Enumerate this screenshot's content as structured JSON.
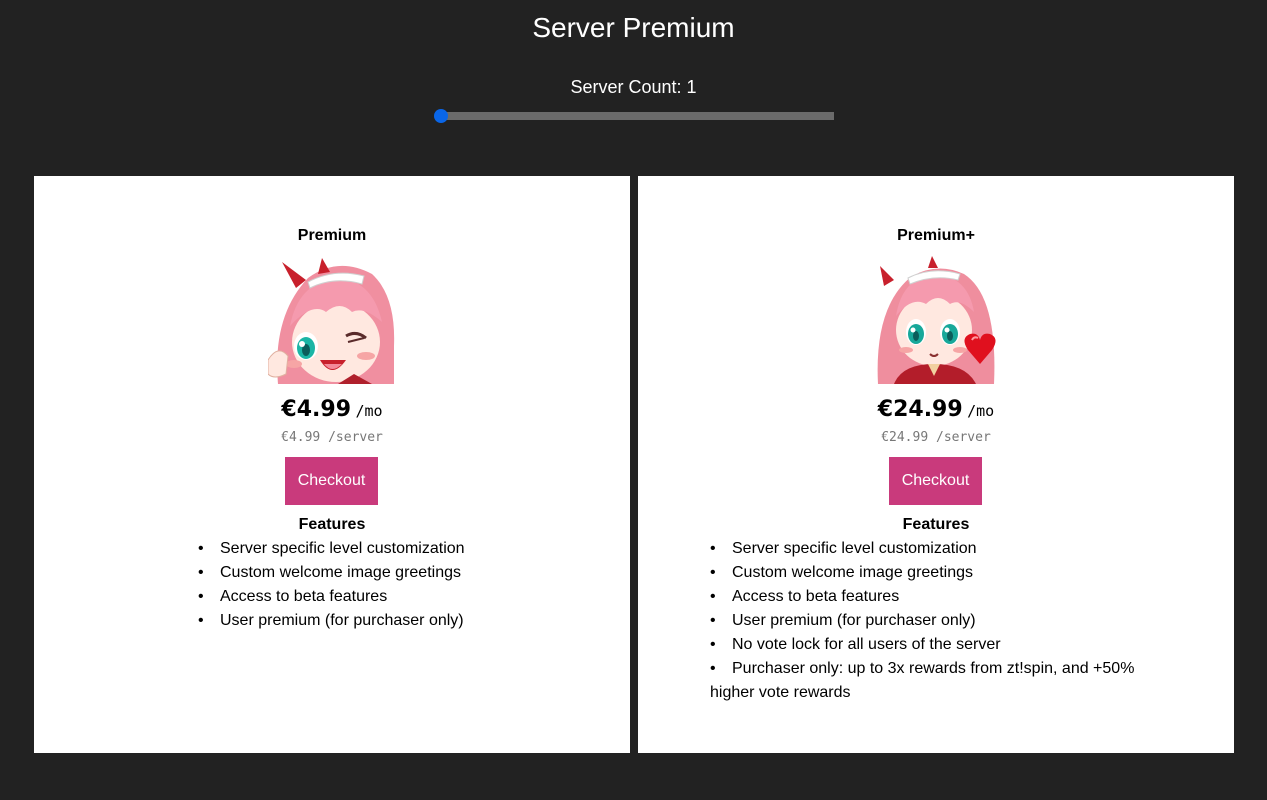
{
  "header": {
    "title": "Server Premium",
    "server_count_label": "Server Count: 1"
  },
  "slider": {
    "value": 1,
    "min": 1,
    "fraction": 0,
    "accent_color": "#0a66e8"
  },
  "tiers": [
    {
      "name": "Premium",
      "avatar_icon": "anime-girl-wink-avatar",
      "price": "€4.99",
      "price_unit": "/mo",
      "per_server": "€4.99 /server",
      "checkout_label": "Checkout",
      "features_title": "Features",
      "features": [
        "Server specific level customization",
        "Custom welcome image greetings",
        "Access to beta features",
        "User premium (for purchaser only)"
      ]
    },
    {
      "name": "Premium+",
      "avatar_icon": "anime-girl-heart-avatar",
      "price": "€24.99",
      "price_unit": "/mo",
      "per_server": "€24.99 /server",
      "checkout_label": "Checkout",
      "features_title": "Features",
      "features": [
        "Server specific level customization",
        "Custom welcome image greetings",
        "Access to beta features",
        "User premium (for purchaser only)",
        "No vote lock for all users of the server",
        "Purchaser only: up to 3x rewards from zt!spin, and +50% higher vote rewards"
      ]
    }
  ],
  "colors": {
    "background": "#222222",
    "card": "#ffffff",
    "checkout": "#c93a7c"
  }
}
